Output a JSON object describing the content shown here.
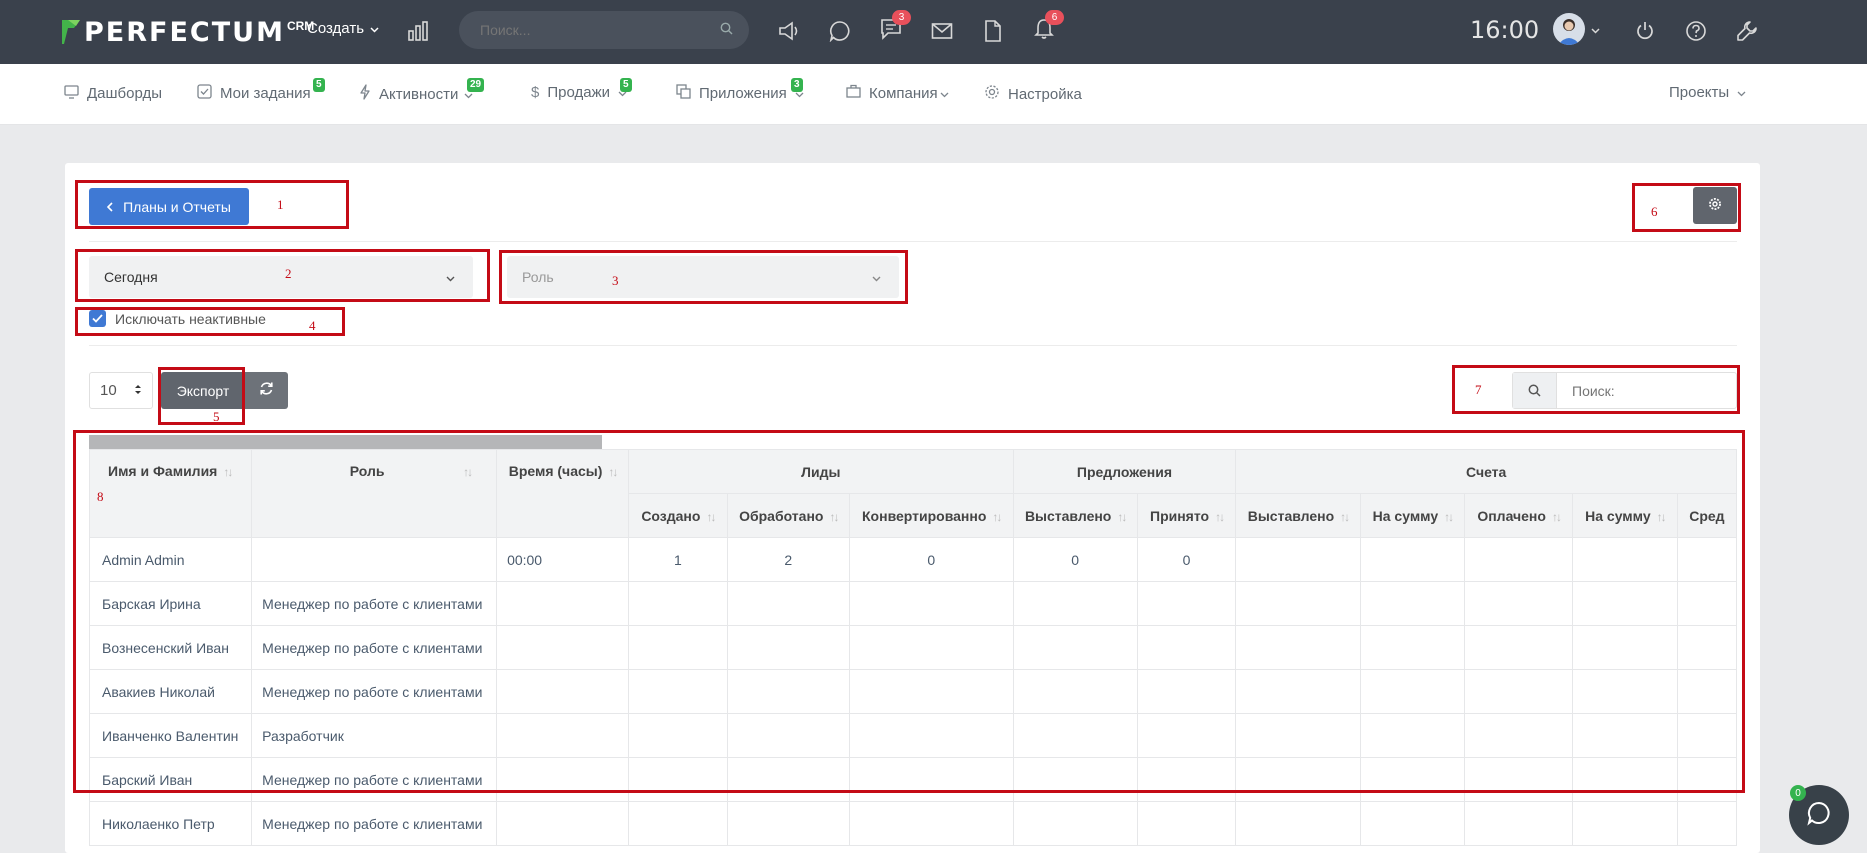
{
  "topbar": {
    "brand": "PERFECTUM",
    "brand_suffix": "CRM",
    "create_label": "Создать",
    "search_placeholder": "Поиск...",
    "chat_badge": "3",
    "notifications_badge": "6",
    "time": "16:00"
  },
  "nav": {
    "items": [
      {
        "label": "Дашборды",
        "icon": "dashboard-icon"
      },
      {
        "label": "Мои задания",
        "icon": "checkbox-icon",
        "badge": "5"
      },
      {
        "label": "Активности",
        "icon": "lightning-icon",
        "badge": "29"
      },
      {
        "label": "Продажи",
        "icon": "dollar-icon",
        "badge": "5"
      },
      {
        "label": "Приложения",
        "icon": "copy-icon",
        "badge": "3"
      },
      {
        "label": "Компания",
        "icon": "briefcase-icon"
      },
      {
        "label": "Настройка",
        "icon": "gear-icon"
      }
    ],
    "projects_label": "Проекты"
  },
  "page": {
    "back_button": "Планы и Отчеты",
    "period_select": "Сегодня",
    "role_select_placeholder": "Роль",
    "exclude_inactive_label": "Исключать неактивные",
    "exclude_inactive_checked": true,
    "per_page": "10",
    "export_label": "Экспорт",
    "search_placeholder": "Поиск:"
  },
  "annotations": [
    "1",
    "2",
    "3",
    "4",
    "5",
    "6",
    "7",
    "8"
  ],
  "table": {
    "headers_top": {
      "name": "Имя и Фамилия",
      "role": "Роль",
      "time": "Время (часы)",
      "leads": "Лиды",
      "offers": "Предложения",
      "invoices": "Счета"
    },
    "headers_sub": {
      "created": "Создано",
      "processed": "Обработано",
      "converted": "Конвертированно",
      "offers_issued": "Выставлено",
      "offers_accepted": "Принято",
      "inv_issued": "Выставлено",
      "inv_sum": "На сумму",
      "paid": "Оплачено",
      "paid_sum": "На сумму",
      "avg": "Сред"
    },
    "rows": [
      {
        "name": "Admin Admin",
        "role": "",
        "time": "00:00",
        "created": "1",
        "processed": "2",
        "converted": "0",
        "offers_issued": "0",
        "offers_accepted": "0"
      },
      {
        "name": "Барская Ирина",
        "role": "Менеджер по работе с клиентами",
        "time": "",
        "created": "",
        "processed": "",
        "converted": "",
        "offers_issued": "",
        "offers_accepted": ""
      },
      {
        "name": "Вознесенский Иван",
        "role": "Менеджер по работе с клиентами",
        "time": "",
        "created": "",
        "processed": "",
        "converted": "",
        "offers_issued": "",
        "offers_accepted": ""
      },
      {
        "name": "Авакиев Николай",
        "role": "Менеджер по работе с клиентами",
        "time": "",
        "created": "",
        "processed": "",
        "converted": "",
        "offers_issued": "",
        "offers_accepted": ""
      },
      {
        "name": "Иванченко Валентин",
        "role": "Разработчик",
        "time": "",
        "created": "",
        "processed": "",
        "converted": "",
        "offers_issued": "",
        "offers_accepted": ""
      },
      {
        "name": "Барский Иван",
        "role": "Менеджер по работе с клиентами",
        "time": "",
        "created": "",
        "processed": "",
        "converted": "",
        "offers_issued": "",
        "offers_accepted": ""
      },
      {
        "name": "Николаенко Петр",
        "role": "Менеджер по работе с клиентами",
        "time": "",
        "created": "",
        "processed": "",
        "converted": "",
        "offers_issued": "",
        "offers_accepted": ""
      }
    ]
  },
  "chat_widget_badge": "0",
  "colors": {
    "topbar": "#3a414c",
    "primary": "#3f79d4",
    "badge_red": "#e8505b",
    "badge_green": "#34b34f",
    "annotation_red": "#c40b16"
  }
}
